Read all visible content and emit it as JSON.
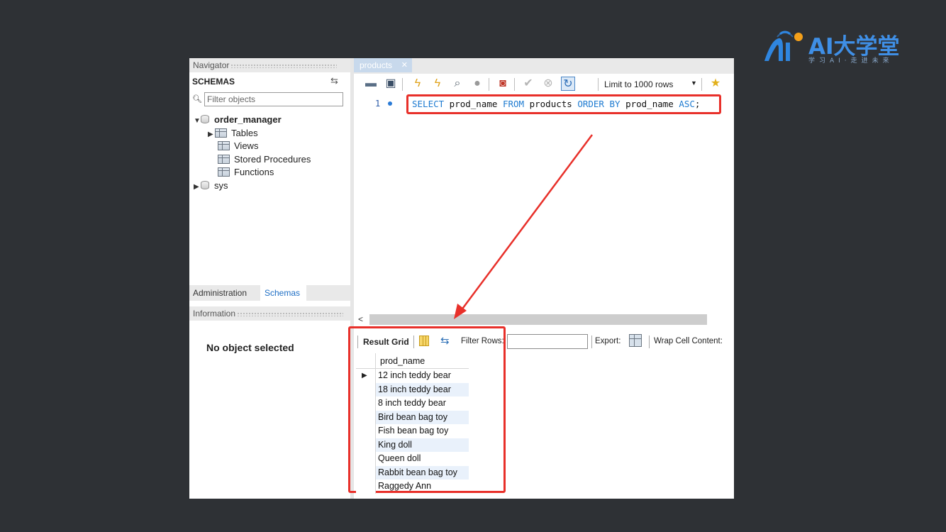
{
  "logo": {
    "text": "AI大学堂",
    "tagline": "学习AI·走进未来"
  },
  "navigator": {
    "title": "Navigator",
    "schemas_header": "SCHEMAS",
    "filter_placeholder": "Filter objects",
    "tree": {
      "db1": "order_manager",
      "items": [
        "Tables",
        "Views",
        "Stored Procedures",
        "Functions"
      ],
      "db2": "sys"
    },
    "tab_admin": "Administration",
    "tab_schemas": "Schemas",
    "info_title": "Information",
    "no_object": "No object selected"
  },
  "editor": {
    "tab_name": "products",
    "limit_label": "Limit to 1000 rows",
    "line_number": "1",
    "sql": {
      "kw1": "SELECT",
      "p1": " prod_name ",
      "kw2": "FROM",
      "p2": " products ",
      "kw3": "ORDER BY",
      "p3": " prod_name ",
      "kw4": "ASC",
      "p4": ";"
    }
  },
  "result": {
    "grid_label": "Result Grid",
    "filter_label": "Filter Rows:",
    "export_label": "Export:",
    "wrap_label": "Wrap Cell Content:",
    "column": "prod_name",
    "rows": [
      "12 inch teddy bear",
      "18 inch teddy bear",
      "8 inch teddy bear",
      "Bird bean bag toy",
      "Fish bean bag toy",
      "King doll",
      "Queen doll",
      "Rabbit bean bag toy",
      "Raggedy Ann"
    ]
  },
  "colors": {
    "highlight": "#e8302a",
    "keyword": "#1e7bd1",
    "background": "#2e3135"
  }
}
